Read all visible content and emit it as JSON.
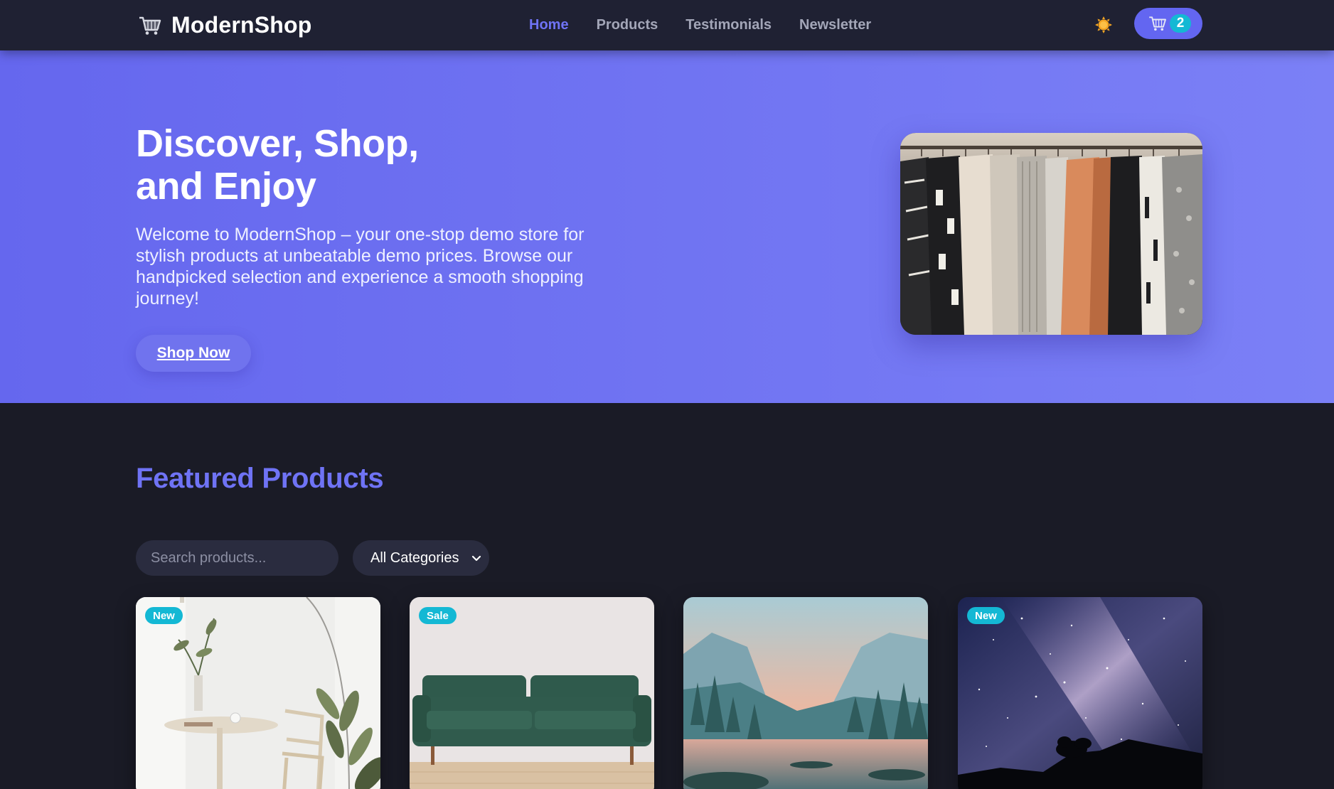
{
  "navbar": {
    "brand": "ModernShop",
    "brand_icon": "shopping-cart-icon",
    "links": [
      {
        "label": "Home",
        "active": true
      },
      {
        "label": "Products",
        "active": false
      },
      {
        "label": "Testimonials",
        "active": false
      },
      {
        "label": "Newsletter",
        "active": false
      }
    ],
    "theme_icon": "sun-icon",
    "cart": {
      "icon": "shopping-cart-icon",
      "count": "2"
    }
  },
  "hero": {
    "title_line1": "Discover, Shop,",
    "title_line2": "and Enjoy",
    "description": "Welcome to ModernShop – your one-stop demo store for stylish products at unbeatable demo prices. Browse our handpicked selection and experience a smooth shopping journey!",
    "cta": "Shop Now",
    "image": "clothing-rack-photo"
  },
  "featured": {
    "title": "Featured Products",
    "search": {
      "placeholder": "Search products...",
      "value": ""
    },
    "category": {
      "selected": "All Categories"
    },
    "products": [
      {
        "badge": "New",
        "image": "dining-room-photo"
      },
      {
        "badge": "Sale",
        "image": "green-sofa-photo"
      },
      {
        "badge": "",
        "image": "mountain-lake-photo"
      },
      {
        "badge": "New",
        "image": "milky-way-photo"
      }
    ]
  },
  "colors": {
    "accent": "#6366f1",
    "nav_bg": "#1f2133",
    "page_bg": "#1a1b26",
    "badge": "#14b8d4",
    "theme_sun": "#f59e0b"
  }
}
